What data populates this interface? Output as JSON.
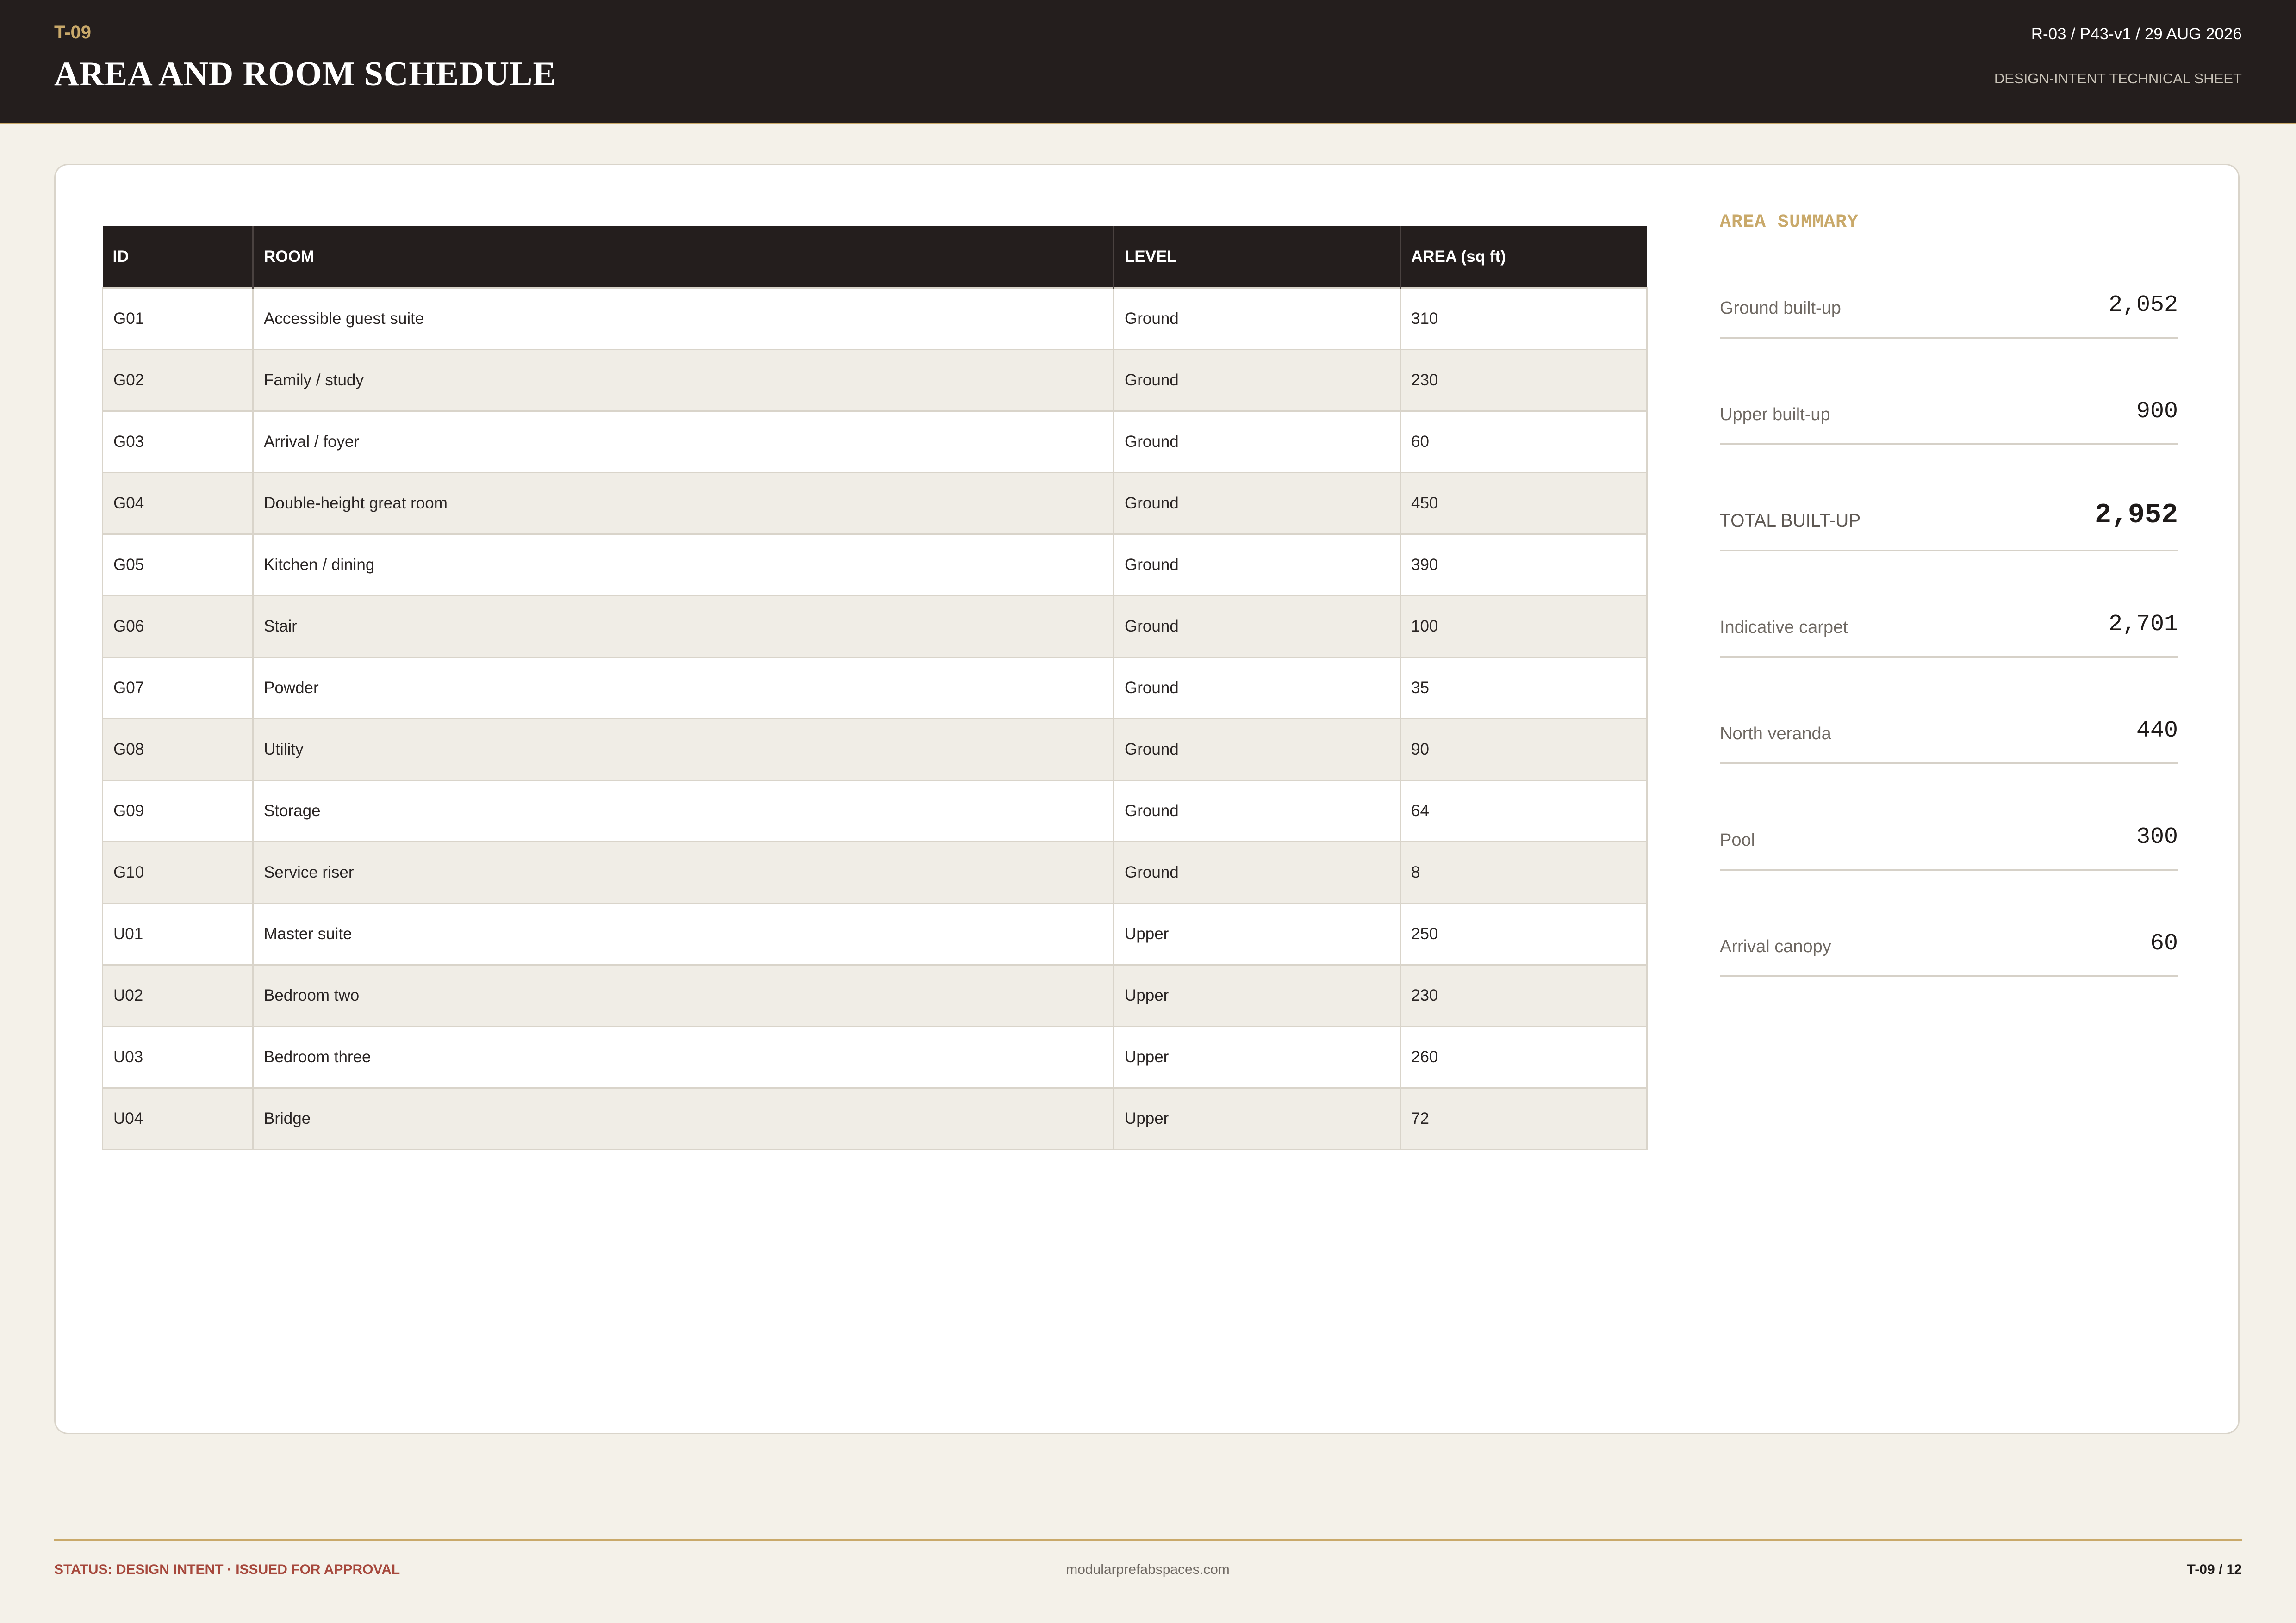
{
  "header": {
    "sheet_code": "T-09",
    "title": "AREA AND ROOM SCHEDULE",
    "revision": "R-03 / P43-v1 / 29 AUG 2026",
    "sheet_type": "DESIGN-INTENT TECHNICAL SHEET"
  },
  "schedule": {
    "columns": [
      "ID",
      "ROOM",
      "LEVEL",
      "AREA (sq ft)"
    ],
    "rows": [
      [
        "G01",
        "Accessible guest suite",
        "Ground",
        "310"
      ],
      [
        "G02",
        "Family / study",
        "Ground",
        "230"
      ],
      [
        "G03",
        "Arrival / foyer",
        "Ground",
        "60"
      ],
      [
        "G04",
        "Double-height great room",
        "Ground",
        "450"
      ],
      [
        "G05",
        "Kitchen / dining",
        "Ground",
        "390"
      ],
      [
        "G06",
        "Stair",
        "Ground",
        "100"
      ],
      [
        "G07",
        "Powder",
        "Ground",
        "35"
      ],
      [
        "G08",
        "Utility",
        "Ground",
        "90"
      ],
      [
        "G09",
        "Storage",
        "Ground",
        "64"
      ],
      [
        "G10",
        "Service riser",
        "Ground",
        "8"
      ],
      [
        "U01",
        "Master suite",
        "Upper",
        "250"
      ],
      [
        "U02",
        "Bedroom two",
        "Upper",
        "230"
      ],
      [
        "U03",
        "Bedroom three",
        "Upper",
        "260"
      ],
      [
        "U04",
        "Bridge",
        "Upper",
        "72"
      ]
    ]
  },
  "summary": {
    "title": "AREA SUMMARY",
    "items": [
      {
        "label": "Ground built-up",
        "value": "2,052"
      },
      {
        "label": "Upper built-up",
        "value": "900"
      },
      {
        "label": "TOTAL BUILT-UP",
        "value": "2,952"
      },
      {
        "label": "Indicative carpet",
        "value": "2,701"
      },
      {
        "label": "North veranda",
        "value": "440"
      },
      {
        "label": "Pool",
        "value": "300"
      },
      {
        "label": "Arrival canopy",
        "value": "60"
      }
    ]
  },
  "footer": {
    "status": "STATUS: DESIGN INTENT · ISSUED FOR APPROVAL",
    "website": "modularprefabspaces.com",
    "page": "T-09 / 12"
  },
  "colors": {
    "header_bg": "#241e1d",
    "accent_gold": "#c9a96a",
    "status_red": "#a6483c",
    "page_bg": "#f4f1e9"
  }
}
